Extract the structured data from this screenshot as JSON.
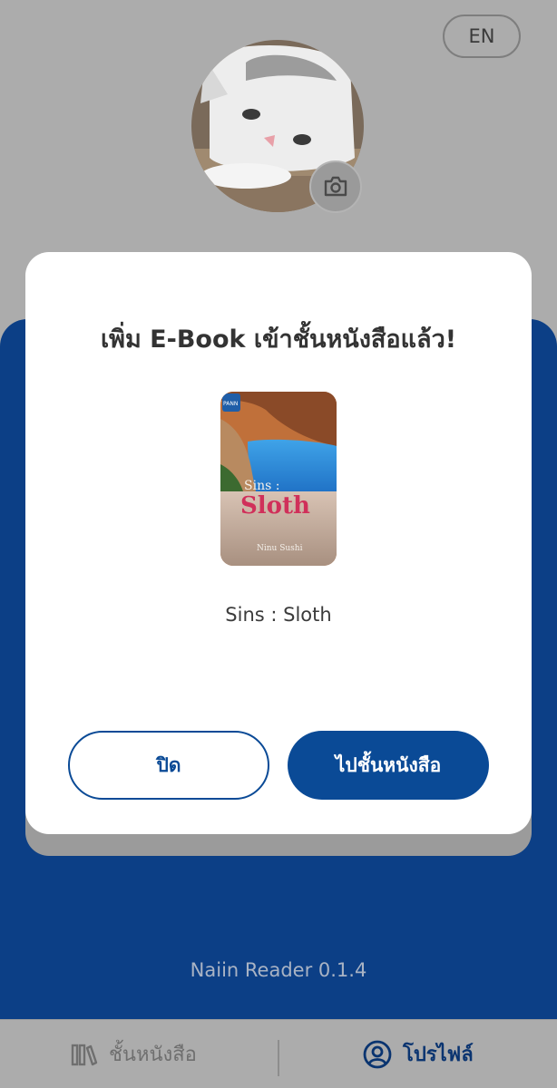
{
  "header": {
    "language_toggle": "EN"
  },
  "profile": {
    "avatar_icon": "cat-photo",
    "camera_icon": "camera-icon"
  },
  "modal": {
    "title": "เพิ่ม E-Book เข้าชั้นหนังสือแล้ว!",
    "book": {
      "title": "Sins : Sloth",
      "cover_text_small": "Sins :",
      "cover_text_large": "Sloth",
      "cover_author": "Ninu Sushi",
      "cover_badge": "PANN"
    },
    "close_label": "ปิด",
    "go_label": "ไปชั้นหนังสือ"
  },
  "footer": {
    "version": "Naiin Reader 0.1.4"
  },
  "nav": {
    "bookshelf_label": "ชั้นหนังสือ",
    "profile_label": "โปรไฟล์"
  },
  "colors": {
    "primary": "#0a4a96",
    "panel": "#0c3f86",
    "overlay": "#acacac"
  }
}
